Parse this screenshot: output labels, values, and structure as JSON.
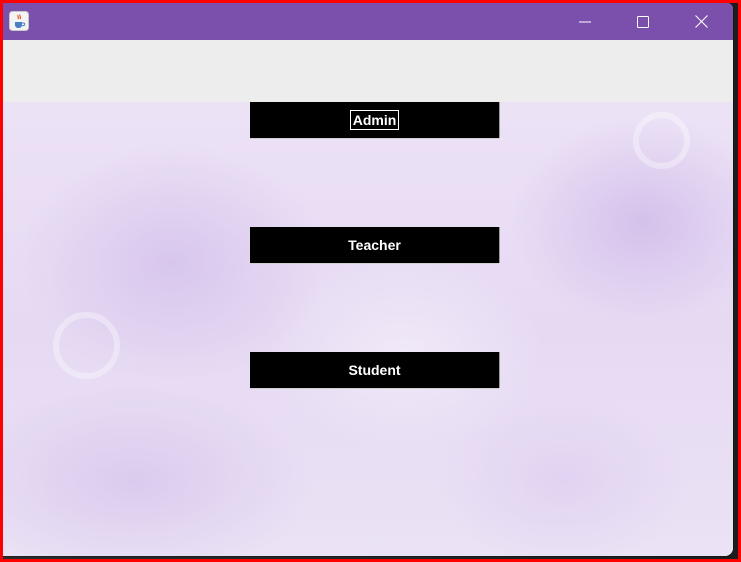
{
  "window": {
    "title": "",
    "titlebar_color": "#7b4fac",
    "app_icon": "java-cup-icon",
    "controls": [
      "minimize-icon",
      "maximize-icon",
      "close-icon"
    ]
  },
  "buttons": [
    {
      "label": "Admin",
      "focused": true
    },
    {
      "label": "Teacher",
      "focused": false
    },
    {
      "label": "Student",
      "focused": false
    }
  ],
  "colors": {
    "button_bg": "#000000",
    "button_text": "#ffffff",
    "background_tint": "#e6daf3",
    "highlight_frame": "#ff0000"
  }
}
